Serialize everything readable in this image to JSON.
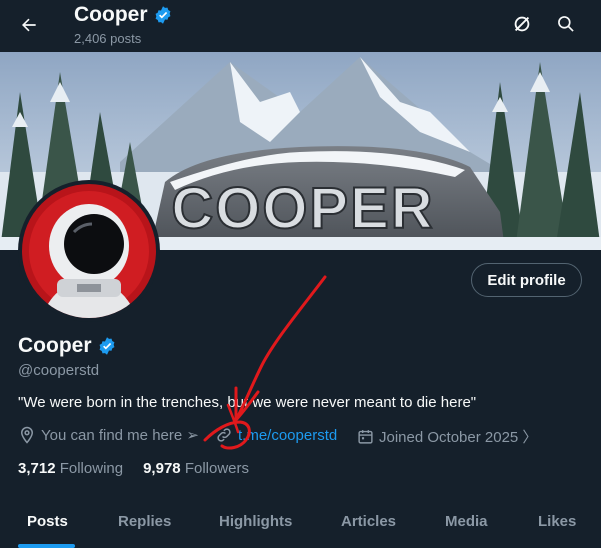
{
  "header": {
    "title": "Cooper",
    "post_count": "2,406 posts"
  },
  "banner": {
    "text": "COOPER"
  },
  "profile": {
    "name": "Cooper",
    "handle": "@cooperstd",
    "bio": "\"We were born in the trenches, but we were never meant to die here\"",
    "location": "You can find me here ➢",
    "link": "t.me/cooperstd",
    "joined": "Joined October 2025 〉",
    "following_count": "3,712",
    "following_label": "Following",
    "followers_count": "9,978",
    "followers_label": "Followers",
    "edit_label": "Edit profile"
  },
  "tabs": [
    {
      "label": "Posts",
      "active": true
    },
    {
      "label": "Replies"
    },
    {
      "label": "Highlights"
    },
    {
      "label": "Articles"
    },
    {
      "label": "Media"
    },
    {
      "label": "Likes"
    }
  ],
  "colors": {
    "background": "#15202b",
    "accent": "#1d9bf0",
    "muted": "#8b98a5",
    "verified": "#1d9bf0",
    "annotation": "#e0191c"
  },
  "icons": [
    "back-arrow-icon",
    "verified-badge-icon",
    "grok-icon",
    "search-icon",
    "location-pin-icon",
    "link-icon",
    "calendar-icon"
  ]
}
